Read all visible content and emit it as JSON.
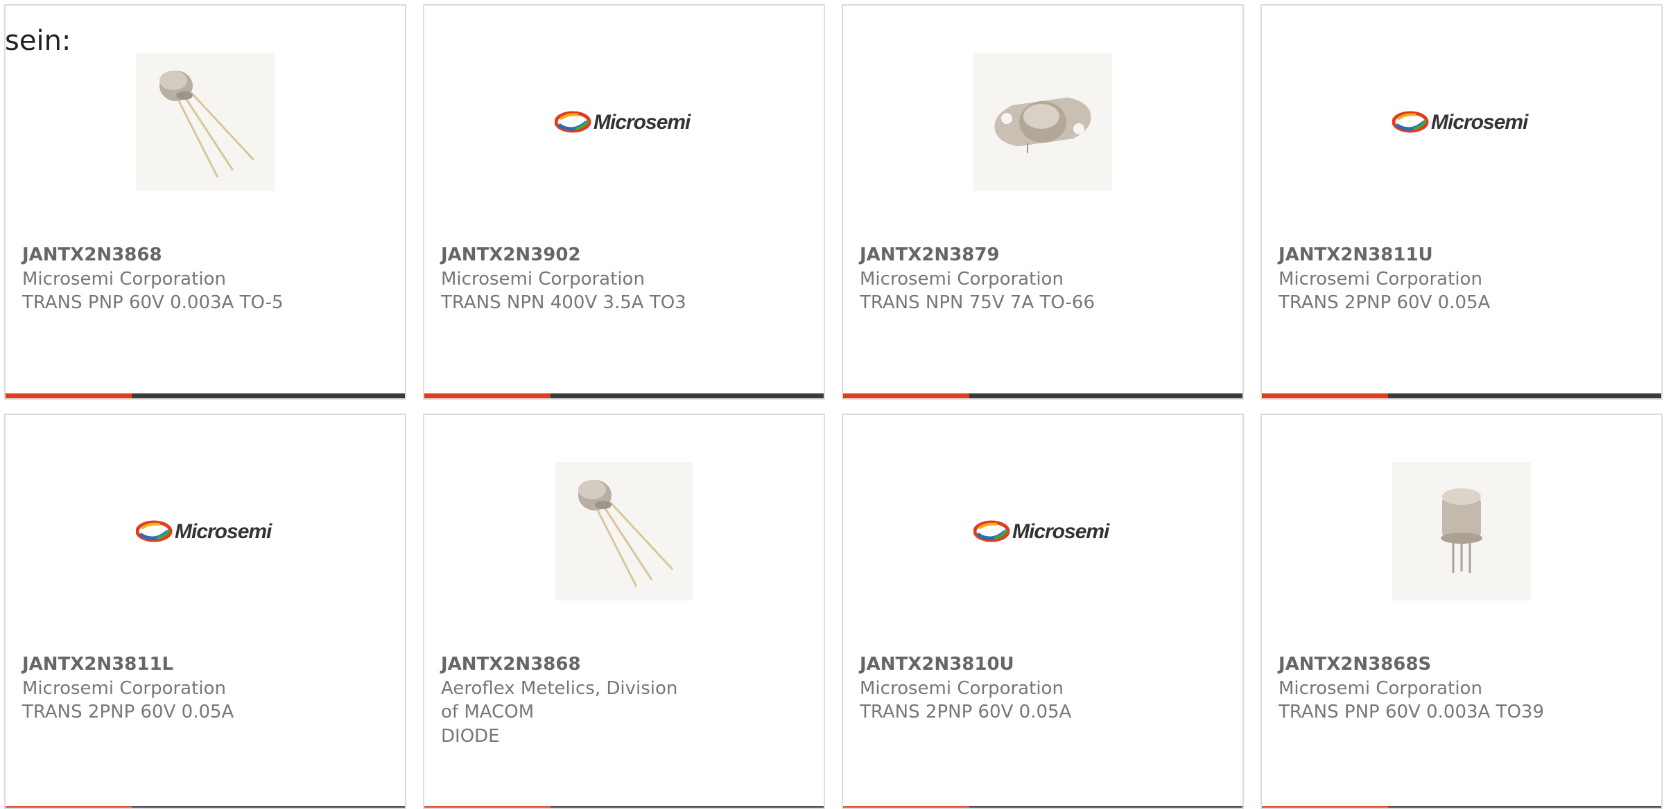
{
  "intro_text": "sein:",
  "colors": {
    "accent": "#e03e1b",
    "bar_dark": "#3b3b3b",
    "card_border": "#dcdcdc",
    "text": "#777777"
  },
  "products": [
    {
      "part_number": "JANTX2N3868",
      "manufacturer": "Microsemi Corporation",
      "description": "TRANS PNP 60V 0.003A TO-5",
      "image": "to5-transistor-image"
    },
    {
      "part_number": "JANTX2N3902",
      "manufacturer": "Microsemi Corporation",
      "description": "TRANS NPN 400V 3.5A TO3",
      "image": "microsemi-logo"
    },
    {
      "part_number": "JANTX2N3879",
      "manufacturer": "Microsemi Corporation",
      "description": "TRANS NPN 75V 7A TO-66",
      "image": "to66-transistor-image"
    },
    {
      "part_number": "JANTX2N3811U",
      "manufacturer": "Microsemi Corporation",
      "description": "TRANS 2PNP 60V 0.05A",
      "image": "microsemi-logo"
    },
    {
      "part_number": "JANTX2N3811L",
      "manufacturer": "Microsemi Corporation",
      "description": "TRANS 2PNP 60V 0.05A",
      "image": "microsemi-logo"
    },
    {
      "part_number": "JANTX2N3868",
      "manufacturer": "Aeroflex Metelics, Division of MACOM",
      "description": "DIODE",
      "image": "to5-transistor-image"
    },
    {
      "part_number": "JANTX2N3810U",
      "manufacturer": "Microsemi Corporation",
      "description": "TRANS 2PNP 60V 0.05A",
      "image": "microsemi-logo"
    },
    {
      "part_number": "JANTX2N3868S",
      "manufacturer": "Microsemi Corporation",
      "description": "TRANS PNP 60V 0.003A TO39",
      "image": "to39-transistor-image"
    }
  ],
  "logo_text": "Microsemi"
}
